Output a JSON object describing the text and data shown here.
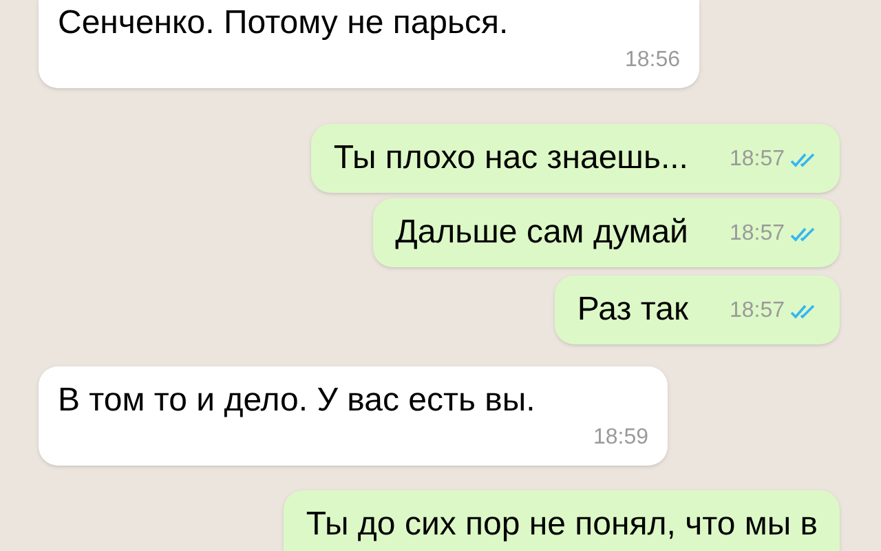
{
  "messages": [
    {
      "kind": "incoming",
      "text": "Сенченко. Потому не парься.",
      "time": "18:56"
    },
    {
      "kind": "outgoing",
      "text": "Ты плохо нас знаешь...",
      "time": "18:57",
      "read": true
    },
    {
      "kind": "outgoing",
      "text": "Дальше сам думай",
      "time": "18:57",
      "read": true
    },
    {
      "kind": "outgoing",
      "text": "Раз так",
      "time": "18:57",
      "read": true
    },
    {
      "kind": "incoming",
      "text": "В том то и дело. У вас есть вы.",
      "time": "18:59"
    },
    {
      "kind": "outgoing",
      "text": "Ты до сих пор не понял, что мы в"
    }
  ]
}
